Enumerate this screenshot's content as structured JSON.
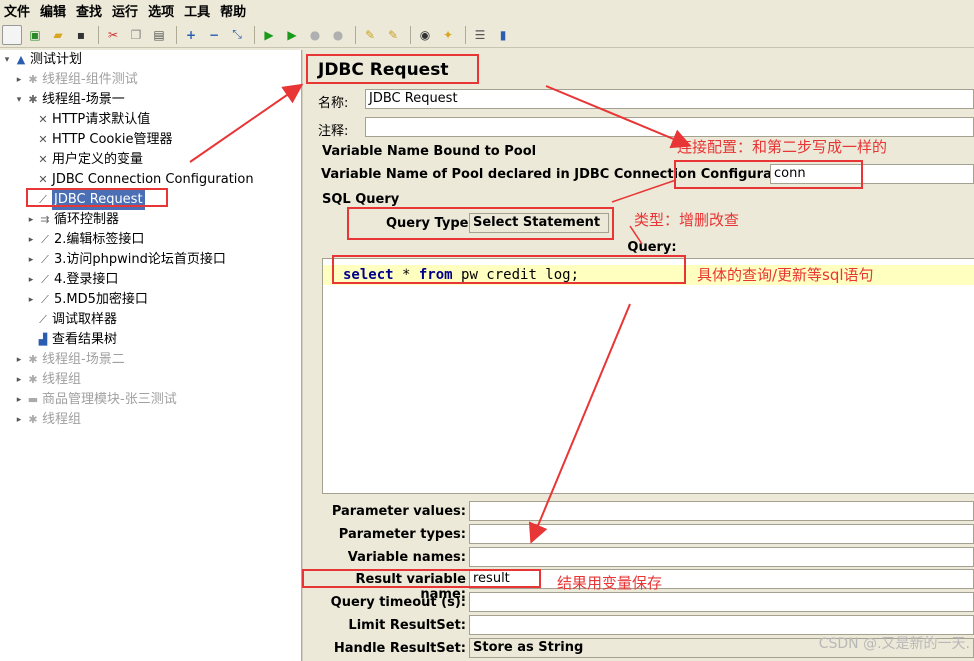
{
  "menu": [
    "文件",
    "编辑",
    "查找",
    "运行",
    "选项",
    "工具",
    "帮助"
  ],
  "tree": {
    "root": "测试计划",
    "items": [
      {
        "label": "线程组-组件测试",
        "disabled": true
      },
      {
        "label": "线程组-场景一",
        "disabled": false
      },
      {
        "label": "HTTP请求默认值",
        "disabled": false
      },
      {
        "label": "HTTP Cookie管理器",
        "disabled": false
      },
      {
        "label": "用户定义的变量",
        "disabled": false
      },
      {
        "label": "JDBC Connection Configuration",
        "disabled": false
      },
      {
        "label": "JDBC Request",
        "disabled": false,
        "selected": true
      },
      {
        "label": "循环控制器",
        "disabled": false
      },
      {
        "label": "2.编辑标签接口",
        "disabled": false
      },
      {
        "label": "3.访问phpwind论坛首页接口",
        "disabled": false
      },
      {
        "label": "4.登录接口",
        "disabled": false
      },
      {
        "label": "5.MD5加密接口",
        "disabled": false
      },
      {
        "label": "调试取样器",
        "disabled": false
      },
      {
        "label": "查看结果树",
        "disabled": false
      },
      {
        "label": "线程组-场景二",
        "disabled": true
      },
      {
        "label": "线程组",
        "disabled": true
      },
      {
        "label": "商品管理模块-张三测试",
        "disabled": true
      },
      {
        "label": "线程组",
        "disabled": true
      }
    ]
  },
  "panel": {
    "title": "JDBC Request",
    "name_label": "名称:",
    "name_value": "JDBC Request",
    "comment_label": "注释:",
    "comment_value": "",
    "var_bound_heading": "Variable Name Bound to Pool",
    "pool_label": "Variable Name of Pool declared in JDBC Connection Configuration:",
    "pool_value": "conn",
    "sql_heading": "SQL Query",
    "query_type_label": "Query Type:",
    "query_type_value": "Select Statement",
    "query_header": "Query:",
    "sql_kw1": "select",
    "sql_star": " * ",
    "sql_kw2": "from",
    "sql_rest": " pw_credit_log;",
    "params": [
      {
        "label": "Parameter values:",
        "value": ""
      },
      {
        "label": "Parameter types:",
        "value": ""
      },
      {
        "label": "Variable names:",
        "value": ""
      },
      {
        "label": "Result variable name:",
        "value": "result"
      },
      {
        "label": "Query timeout (s):",
        "value": ""
      },
      {
        "label": "Limit ResultSet:",
        "value": ""
      },
      {
        "label": "Handle ResultSet:",
        "value": "Store as String"
      }
    ]
  },
  "annotations": {
    "connection": "连接配置：和第二步写成一样的",
    "type": "类型：增删改查",
    "query": "具体的查询/更新等sql语句",
    "result": "结果用变量保存"
  },
  "watermark": "CSDN @.又是新的一天.",
  "colors": {
    "annotation": "#e83535",
    "selection": "#4a6fb5",
    "sql_highlight": "#ffffc0"
  }
}
